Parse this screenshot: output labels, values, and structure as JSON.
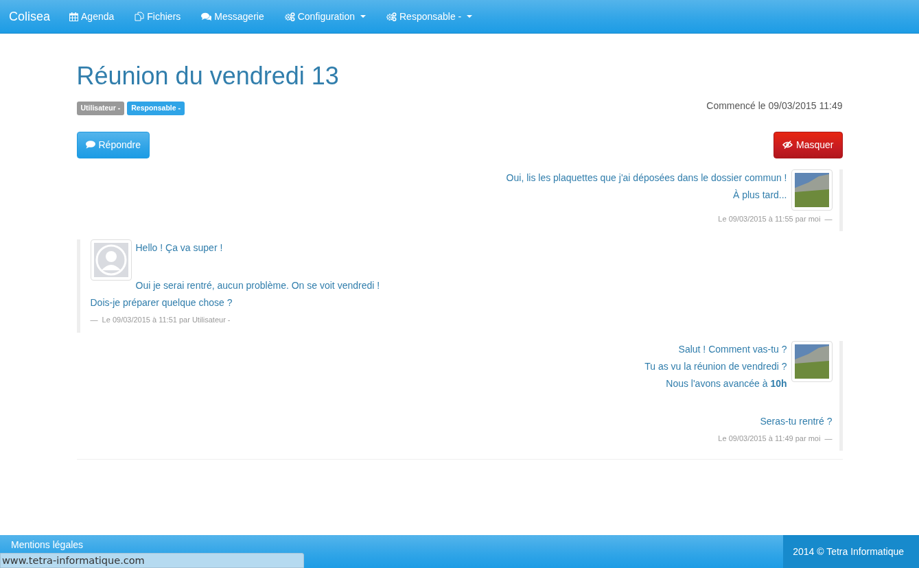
{
  "navbar": {
    "brand": "Colisea",
    "items": [
      {
        "label": "Agenda",
        "dropdown": false
      },
      {
        "label": "Fichiers",
        "dropdown": false
      },
      {
        "label": "Messagerie",
        "dropdown": false
      },
      {
        "label": "Configuration",
        "dropdown": true
      },
      {
        "label": "Responsable -",
        "dropdown": true
      }
    ]
  },
  "title": "Réunion du vendredi 13",
  "participants": [
    {
      "label": "Utilisateur -",
      "color": "#999999"
    },
    {
      "label": "Responsable -",
      "color": "#2fa4e7"
    }
  ],
  "started": "Commencé le 09/03/2015 11:49",
  "reply_button": "Répondre",
  "hide_button": "Masquer",
  "messages": [
    {
      "kind": "mine",
      "paragraphs": [
        [
          "Oui, lis les plaquettes que j'ai déposées dans le dossier commun !",
          "À plus tard..."
        ]
      ],
      "footer": "Le 09/03/2015 à 11:55 par moi  —"
    },
    {
      "kind": "other",
      "paragraphs": [
        [
          "Hello ! Ça va super !"
        ],
        [
          "Oui je serai rentré, aucun problème. On se voit vendredi !",
          "Dois-je préparer quelque chose ?"
        ]
      ],
      "footer": "—  Le 09/03/2015 à 11:51 par Utilisateur -"
    },
    {
      "kind": "mine",
      "paragraphs": [
        [
          "Salut ! Comment vas-tu ?",
          "Tu as vu la réunion de vendredi ?",
          "Nous l'avons avancée à **10h**"
        ],
        [
          "Seras-tu rentré ?"
        ]
      ],
      "footer": "Le 09/03/2015 à 11:49 par moi  —"
    }
  ],
  "footer": {
    "legal": "Mentions légales",
    "copyright": "2014 © Tetra Informatique"
  },
  "status_url": "www.tetra-informatique.com"
}
